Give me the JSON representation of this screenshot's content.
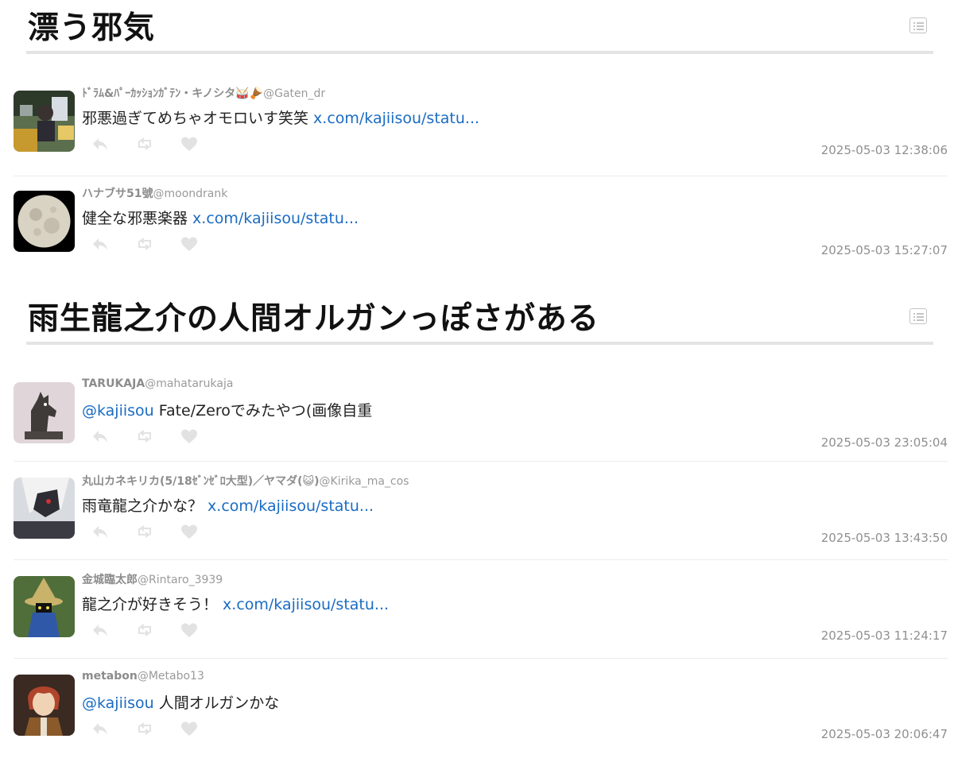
{
  "sections": [
    {
      "title": "漂う邪気",
      "tweets": [
        {
          "name": "ﾄﾞﾗﾑ&ﾊﾟｰｶｯｼｮﾝｶﾞﾃﾝ・キノシタ🥁🪘",
          "handle": "@Gaten_dr",
          "text": "邪悪過ぎてめちゃオモロいす笑笑 ",
          "mention": "",
          "link": "x.com/kajiisou/statu...",
          "time": "2025-05-03 12:38:06",
          "avatar_icon": "avatar-photo-drummer"
        },
        {
          "name": "ハナブサ51號",
          "handle": "@moondrank",
          "text": "健全な邪悪楽器 ",
          "mention": "",
          "link": "x.com/kajiisou/statu...",
          "time": "2025-05-03 15:27:07",
          "avatar_icon": "avatar-full-moon"
        }
      ]
    },
    {
      "title": "雨生龍之介の人間オルガンっぽさがある",
      "tweets": [
        {
          "name": "TARUKAJA",
          "handle": "@mahatarukaja",
          "mention": "@kajiisou",
          "text": " Fate/Zeroでみたやつ(画像自重",
          "link": "",
          "time": "2025-05-03 23:05:04",
          "avatar_icon": "avatar-horse-illustration"
        },
        {
          "name": "丸山カネキリカ(5/18ｾﾞﾝｾﾞﾛ大型)／ヤマダ(😺)",
          "handle": "@Kirika_ma_cos",
          "text": "雨竜龍之介かな？ ",
          "mention": "",
          "link": "x.com/kajiisou/statu...",
          "time": "2025-05-03 13:43:50",
          "avatar_icon": "avatar-cosplay-photo"
        },
        {
          "name": "金城臨太郎",
          "handle": "@Rintaro_3939",
          "text": "龍之介が好きそう！ ",
          "mention": "",
          "link": "x.com/kajiisou/statu...",
          "time": "2025-05-03 11:24:17",
          "avatar_icon": "avatar-black-mage-cosplay"
        },
        {
          "name": "metabon",
          "handle": "@Metabo13",
          "mention": "@kajiisou",
          "text": " 人間オルガンかな",
          "link": "",
          "time": "2025-05-03 20:06:47",
          "avatar_icon": "avatar-anime-character"
        }
      ]
    }
  ],
  "icons": {
    "list": "list-icon",
    "reply": "reply-icon",
    "retweet": "retweet-icon",
    "like": "heart-icon"
  },
  "colors": {
    "link": "#1a6bc2",
    "meta": "#8f8f8f",
    "icon": "#e2e2e2"
  }
}
